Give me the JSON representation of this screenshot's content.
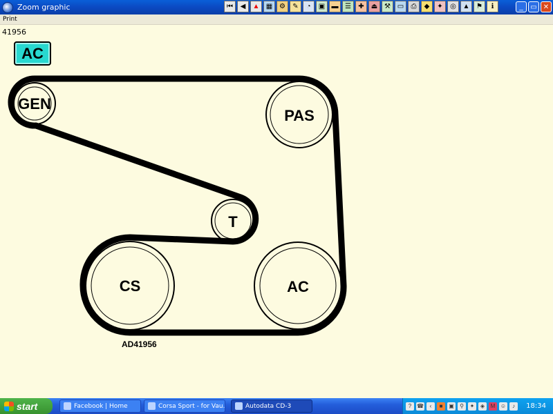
{
  "window": {
    "title": "Zoom graphic",
    "menu": [
      "Print"
    ]
  },
  "toolbar": {
    "icons": [
      "first-page-icon",
      "prev-page-icon",
      "warning-icon",
      "image-icon",
      "gear-icon",
      "tools-icon",
      "clock-icon",
      "picture-icon",
      "car-icon",
      "list-icon",
      "car-repair-icon",
      "exit-icon",
      "wrench-icon",
      "battery-icon",
      "print-icon",
      "car-icon",
      "lamp-icon",
      "tyre-icon",
      "car-icon",
      "flag-icon",
      "car-icon",
      "info-icon"
    ]
  },
  "diagram": {
    "reference_top": "41956",
    "badge": "AC",
    "reference_bottom": "AD41956",
    "pulleys": {
      "gen": "GEN",
      "pas": "PAS",
      "t": "T",
      "cs": "CS",
      "ac": "AC"
    },
    "belt_color": "#000000",
    "badge_color": "#28d8d0"
  },
  "taskbar": {
    "start": "start",
    "tasks": [
      "Facebook | Home",
      "Corsa Sport - for Vau...",
      "Autodata CD-3"
    ],
    "clock": "18:34"
  }
}
